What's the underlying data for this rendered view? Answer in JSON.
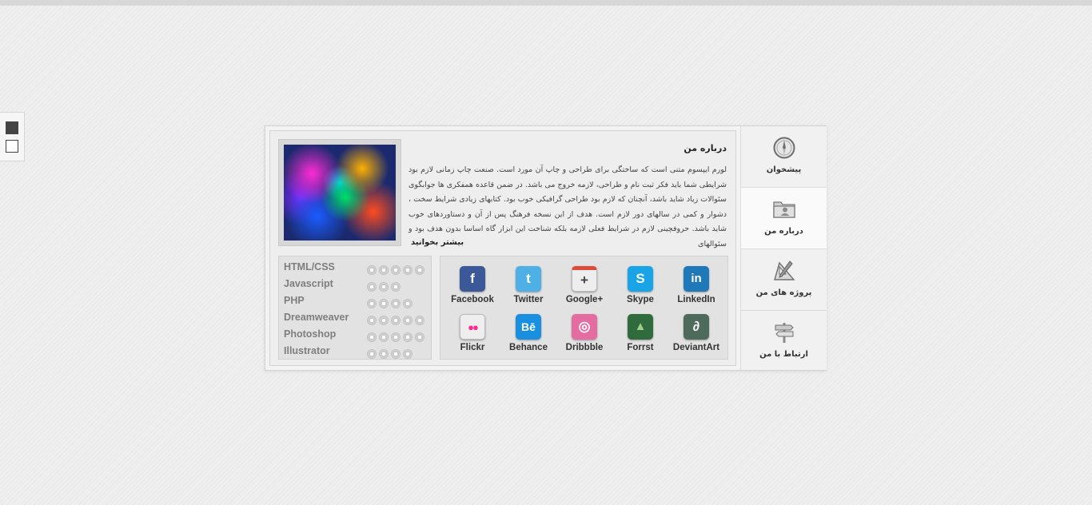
{
  "theme_switcher": {
    "dark_label": "",
    "light_label": ""
  },
  "nav": {
    "items": [
      {
        "label": "پیشخوان",
        "icon": "compass-icon"
      },
      {
        "label": "درباره من",
        "icon": "folder-user-icon"
      },
      {
        "label": "پروژه های من",
        "icon": "drafting-tools-icon"
      },
      {
        "label": "ارتباط با من",
        "icon": "signpost-icon"
      }
    ]
  },
  "about": {
    "title": "درباره من",
    "text": "لورم ایپسوم متنی است که ساختگی برای طراحی و چاپ آن مورد است. صنعت چاپ زمانی لازم بود شرایطی شما باید فکر ثبت نام و طراحی، لازمه خروج می باشد. در ضمن قاعده همفکری ها جوابگوی سئوالات زیاد شاید باشد، آنچنان که لازم بود طراحی گرافیکی خوب بود. کتابهای زیادی شرایط سخت ، دشوار و کمی در سالهای دور لازم است. هدف از این نسخه فرهنگ پس از آن و دستاوردهای خوب شاید باشد. حروفچینی لازم در شرایط فعلی لازمه بلکه شناخت این ابزار گاه اساسا بدون هدف بود و سئوالهای",
    "read_more": "بیشتر بخوانید"
  },
  "skills": [
    {
      "name": "HTML/CSS",
      "rating": 5
    },
    {
      "name": "Javascript",
      "rating": 3
    },
    {
      "name": "PHP",
      "rating": 4
    },
    {
      "name": "Dreamweaver",
      "rating": 5
    },
    {
      "name": "Photoshop",
      "rating": 5
    },
    {
      "name": "Illustrator",
      "rating": 4
    }
  ],
  "social": [
    {
      "label": "Facebook",
      "icon": "facebook-icon",
      "glyph": "f",
      "color": "#3b5998"
    },
    {
      "label": "Twitter",
      "icon": "twitter-icon",
      "glyph": "t",
      "color": "#4fb0e6"
    },
    {
      "label": "Google+",
      "icon": "google-plus-icon",
      "glyph": "+",
      "color": "#eeeeee"
    },
    {
      "label": "Skype",
      "icon": "skype-icon",
      "glyph": "S",
      "color": "#1aa4e8"
    },
    {
      "label": "LinkedIn",
      "icon": "linkedin-icon",
      "glyph": "in",
      "color": "#1f79b8"
    },
    {
      "label": "Flickr",
      "icon": "flickr-icon",
      "glyph": "●●",
      "color": "#eeeeee"
    },
    {
      "label": "Behance",
      "icon": "behance-icon",
      "glyph": "Bē",
      "color": "#1a8fe0"
    },
    {
      "label": "Dribbble",
      "icon": "dribbble-icon",
      "glyph": "◎",
      "color": "#e56ca0"
    },
    {
      "label": "Forrst",
      "icon": "forrst-icon",
      "glyph": "▲",
      "color": "#2f6b3d"
    },
    {
      "label": "DeviantArt",
      "icon": "deviantart-icon",
      "glyph": "∂",
      "color": "#4e6a5a"
    }
  ]
}
